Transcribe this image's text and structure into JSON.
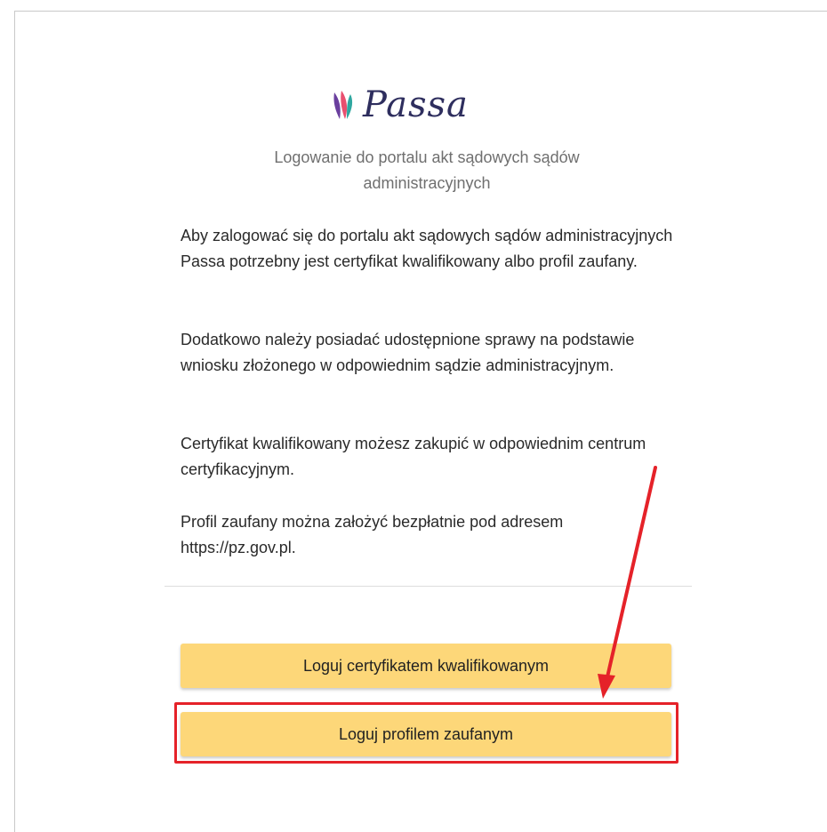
{
  "brand": {
    "logo_text": "Passa",
    "logo_colors": [
      "#6a3f9e",
      "#e94f6f",
      "#2fa7a0"
    ]
  },
  "subtitle": "Logowanie do portalu akt sądowych sądów administracyjnych",
  "paragraphs": [
    "Aby zalogować się do portalu akt sądowych sądów administracyjnych Passa potrzebny jest certyfikat kwalifikowany albo profil zaufany.",
    "Dodatkowo należy posiadać udostępnione sprawy na podstawie wniosku złożonego w odpowiednim sądzie administracyjnym.",
    "Certyfikat kwalifikowany możesz zakupić w odpowiednim centrum certyfikacyjnym.",
    "Profil zaufany można założyć bezpłatnie pod adresem https://pz.gov.pl."
  ],
  "buttons": {
    "certificate_label": "Loguj certyfikatem kwalifikowanym",
    "trusted_profile_label": "Loguj profilem zaufanym"
  },
  "colors": {
    "button_bg": "#fdd779",
    "annotation_red": "#e52229"
  },
  "annotation": {
    "icon": "red-arrow-icon",
    "target": "trusted_profile_button"
  }
}
